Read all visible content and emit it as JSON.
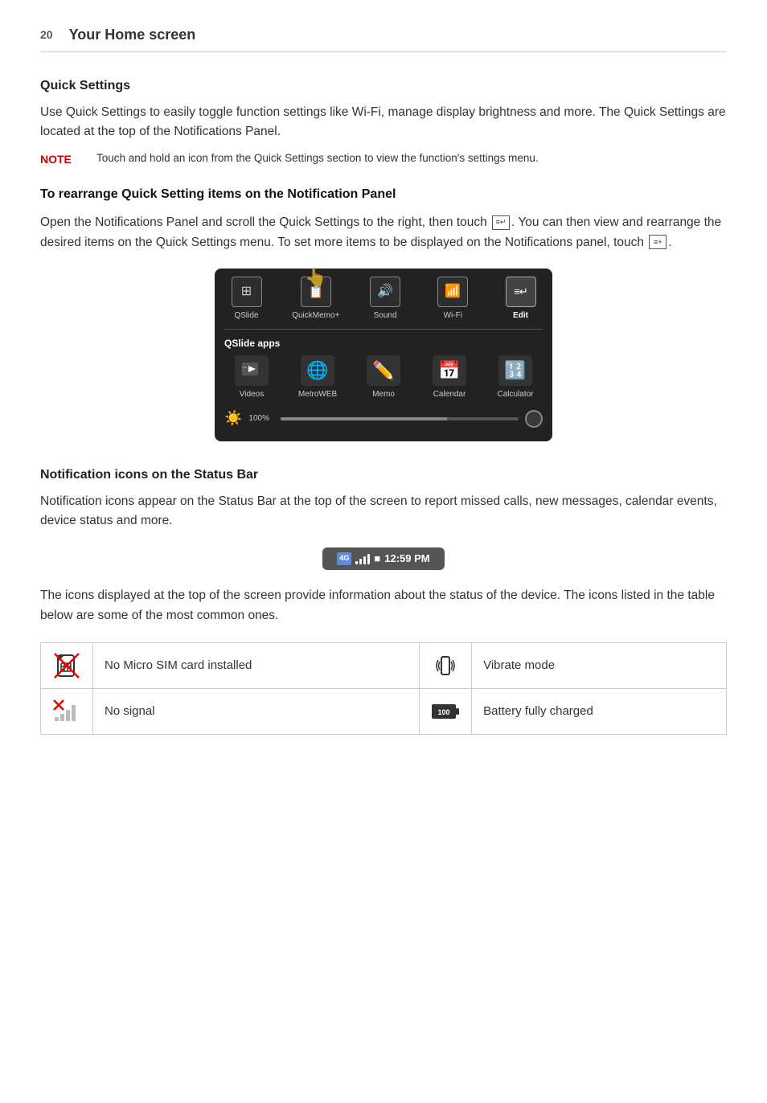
{
  "page": {
    "number": "20",
    "title": "Your Home screen"
  },
  "quick_settings": {
    "section_title": "Quick Settings",
    "body1": "Use Quick Settings to easily toggle function settings like Wi-Fi, manage display brightness and more. The Quick Settings are located at the top of the Notifications Panel.",
    "note_label": "NOTE",
    "note_text": "Touch and hold an icon from the Quick Settings section to view the function's settings menu.",
    "subtitle": "To rearrange Quick Setting items on the Notification Panel",
    "body2": "Open the Notifications Panel and scroll the Quick Settings to the right, then touch",
    "body2b": ". You can then view and rearrange the desired items on the Quick Settings menu. To set more items to be displayed on the Notifications panel, touch",
    "body2c": ".",
    "panel": {
      "icons": [
        {
          "label": "QSlide",
          "symbol": "⊞"
        },
        {
          "label": "QuickMemo+",
          "symbol": "☰"
        },
        {
          "label": "Sound",
          "symbol": "🔊"
        },
        {
          "label": "Wi-Fi",
          "symbol": "📶"
        },
        {
          "label": "Edit",
          "symbol": "≡↵"
        }
      ],
      "apps_section_label": "QSlide apps",
      "apps": [
        {
          "label": "Videos",
          "symbol": "▶"
        },
        {
          "label": "MetroWEB",
          "symbol": "🌐"
        },
        {
          "label": "Memo",
          "symbol": "✏"
        },
        {
          "label": "Calendar",
          "symbol": "▦"
        },
        {
          "label": "Calculator",
          "symbol": "+-"
        }
      ],
      "brightness_label": "100%"
    }
  },
  "notification_icons": {
    "section_title": "Notification icons on the Status Bar",
    "body1": "Notification icons appear on the Status Bar at the top of the screen to report missed calls, new messages, calendar events, device status and more.",
    "status_bar": {
      "network": "4G",
      "signal_bars": 4,
      "battery": "■",
      "time": "12:59 PM"
    },
    "body2": "The icons displayed at the top of the screen provide information about the status of the device. The icons listed in the table below are some of the most common ones.",
    "table": [
      {
        "icon_type": "sim-no",
        "label": "No Micro SIM card installed",
        "icon2_type": "vibrate",
        "label2": "Vibrate mode"
      },
      {
        "icon_type": "no-signal",
        "label": "No signal",
        "icon2_type": "battery-100",
        "label2": "Battery fully charged"
      }
    ]
  }
}
